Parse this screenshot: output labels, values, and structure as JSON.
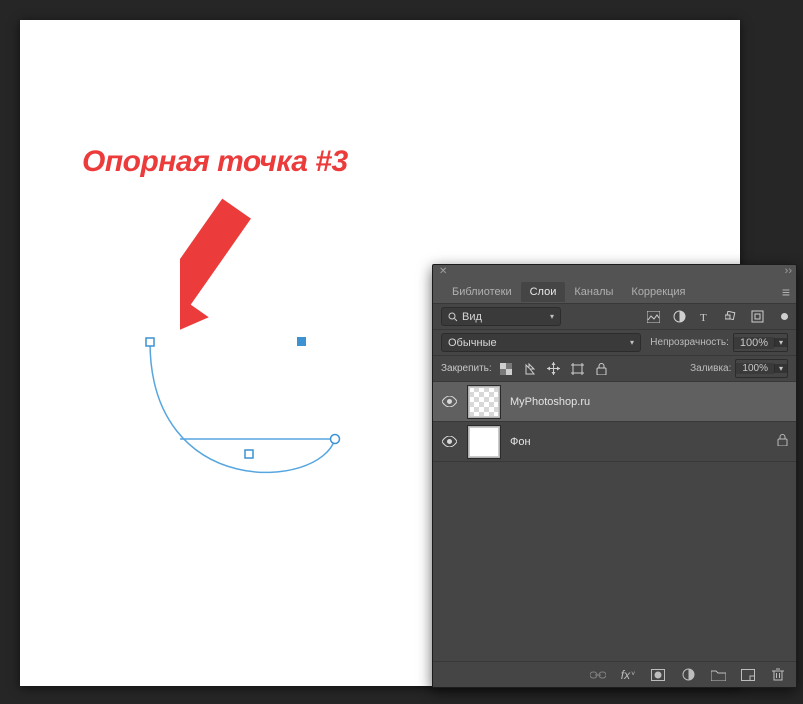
{
  "annotation": {
    "label": "Опорная точка #3",
    "arrow_color": "#eb3b3b"
  },
  "path": {
    "stroke": "#5ea2d6"
  },
  "panel": {
    "tabs": {
      "items": [
        {
          "id": "libs",
          "label": "Библиотеки"
        },
        {
          "id": "layers",
          "label": "Слои"
        },
        {
          "id": "channels",
          "label": "Каналы"
        },
        {
          "id": "adjust",
          "label": "Коррекция"
        }
      ],
      "active_index": 1
    },
    "filter": {
      "kind_label": "Вид"
    },
    "blend": {
      "mode": "Обычные",
      "opacity_label": "Непрозрачность:",
      "opacity_value": "100%"
    },
    "lock": {
      "label": "Закрепить:",
      "fill_label": "Заливка:",
      "fill_value": "100%"
    },
    "layers": [
      {
        "name": "MyPhotoshop.ru",
        "selected": true,
        "transparent": true,
        "locked": false
      },
      {
        "name": "Фон",
        "selected": false,
        "transparent": false,
        "locked": true
      }
    ]
  }
}
